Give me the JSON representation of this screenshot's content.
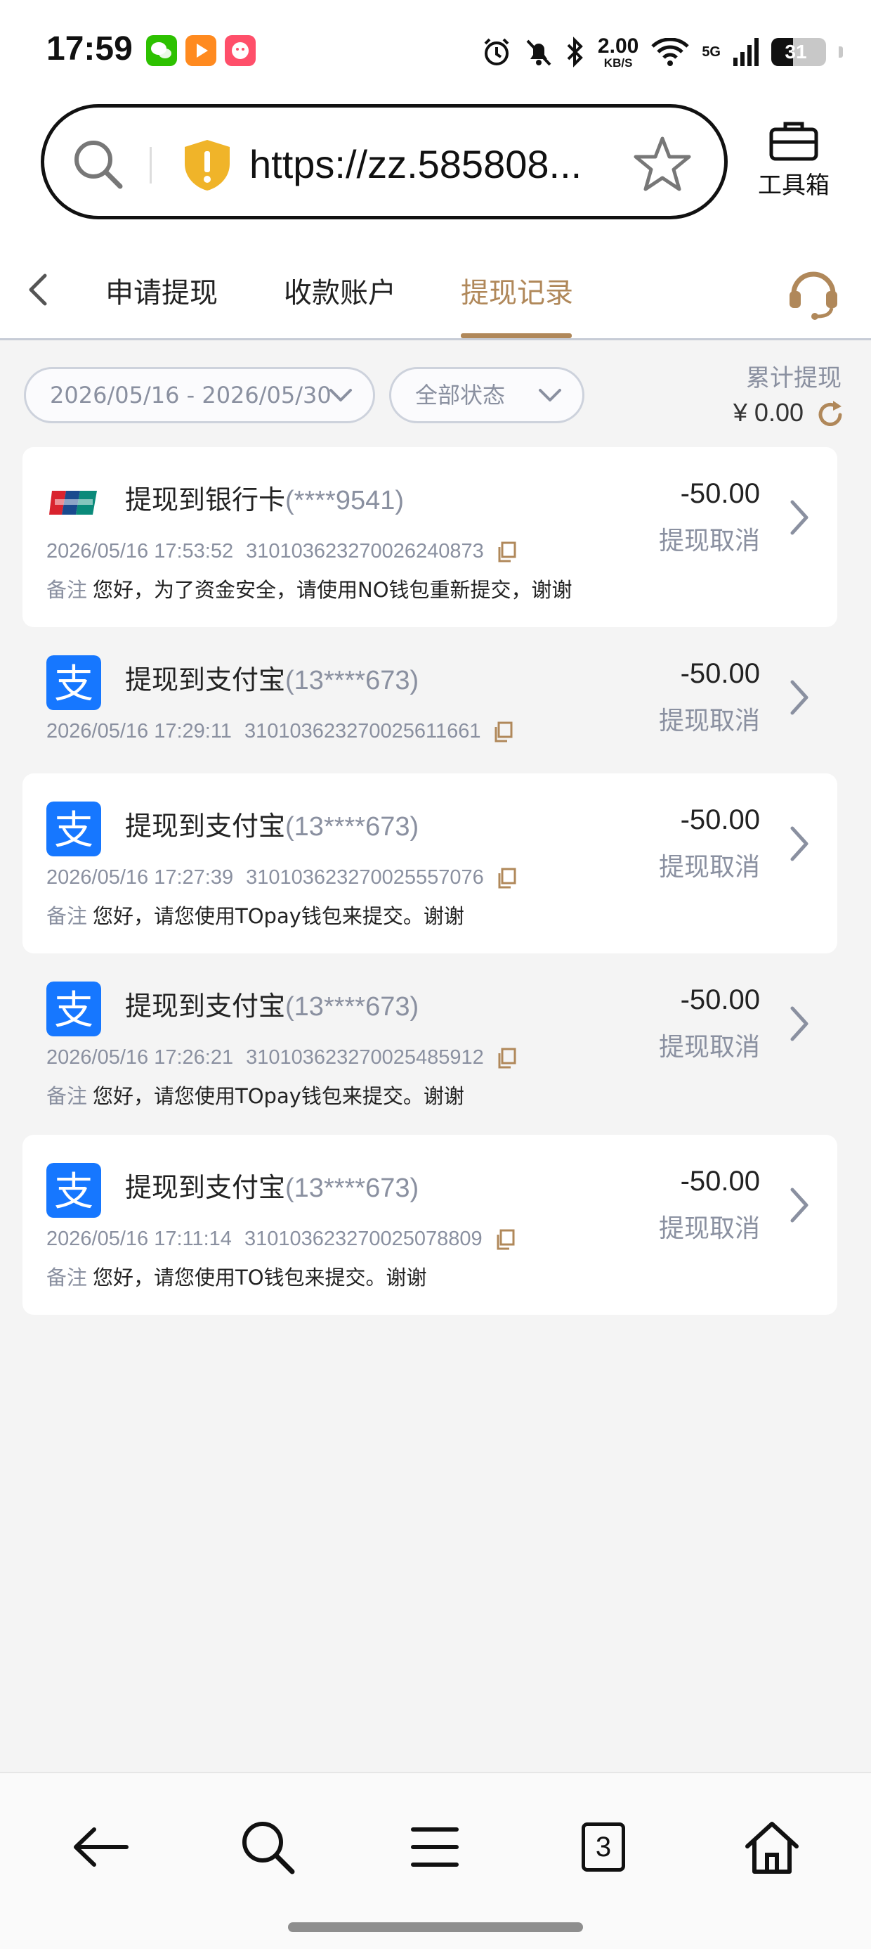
{
  "status_bar": {
    "time": "17:59",
    "net_speed_value": "2.00",
    "net_speed_unit": "KB/S",
    "signal_label": "5G",
    "battery": "31",
    "icons": [
      "wechat-icon",
      "video-app-icon",
      "game-app-icon",
      "alarm-icon",
      "bell-muted-icon",
      "bluetooth-icon",
      "wifi-icon",
      "signal-icon",
      "battery-icon"
    ]
  },
  "browser": {
    "url": "https://zz.585808...",
    "toolbox_label": "工具箱"
  },
  "tabs": {
    "items": [
      {
        "label": "申请提现"
      },
      {
        "label": "收款账户"
      },
      {
        "label": "提现记录"
      }
    ],
    "active_index": 2,
    "accent_color": "#b0885a"
  },
  "filters": {
    "date_range": "2026/05/16 - 2026/05/30",
    "status": "全部状态",
    "total_label": "累计提现",
    "total_value": "¥ 0.00"
  },
  "records": [
    {
      "channel": "unionpay",
      "title": "提现到银行卡",
      "account": "(****9541)",
      "time": "2026/05/16 17:53:52",
      "order_no": "310103623270026240873",
      "note_label": "备注",
      "note": "您好，为了资金安全，请使用NO钱包重新提交，谢谢",
      "amount": "-50.00",
      "status": "提现取消"
    },
    {
      "channel": "alipay",
      "title": "提现到支付宝",
      "account": "(13****673)",
      "time": "2026/05/16 17:29:11",
      "order_no": "310103623270025611661",
      "note_label": "",
      "note": "",
      "amount": "-50.00",
      "status": "提现取消"
    },
    {
      "channel": "alipay",
      "title": "提现到支付宝",
      "account": "(13****673)",
      "time": "2026/05/16 17:27:39",
      "order_no": "310103623270025557076",
      "note_label": "备注",
      "note": "您好，请您使用TOpay钱包来提交。谢谢",
      "amount": "-50.00",
      "status": "提现取消"
    },
    {
      "channel": "alipay",
      "title": "提现到支付宝",
      "account": "(13****673)",
      "time": "2026/05/16 17:26:21",
      "order_no": "310103623270025485912",
      "note_label": "备注",
      "note": "您好，请您使用TOpay钱包来提交。谢谢",
      "amount": "-50.00",
      "status": "提现取消"
    },
    {
      "channel": "alipay",
      "title": "提现到支付宝",
      "account": "(13****673)",
      "time": "2026/05/16 17:11:14",
      "order_no": "310103623270025078809",
      "note_label": "备注",
      "note": "您好，请您使用TO钱包来提交。谢谢",
      "amount": "-50.00",
      "status": "提现取消"
    }
  ],
  "bottom_nav": {
    "tab_count": "3",
    "icons": [
      "back-arrow-icon",
      "search-icon",
      "menu-icon",
      "tabs-icon",
      "home-icon"
    ]
  }
}
